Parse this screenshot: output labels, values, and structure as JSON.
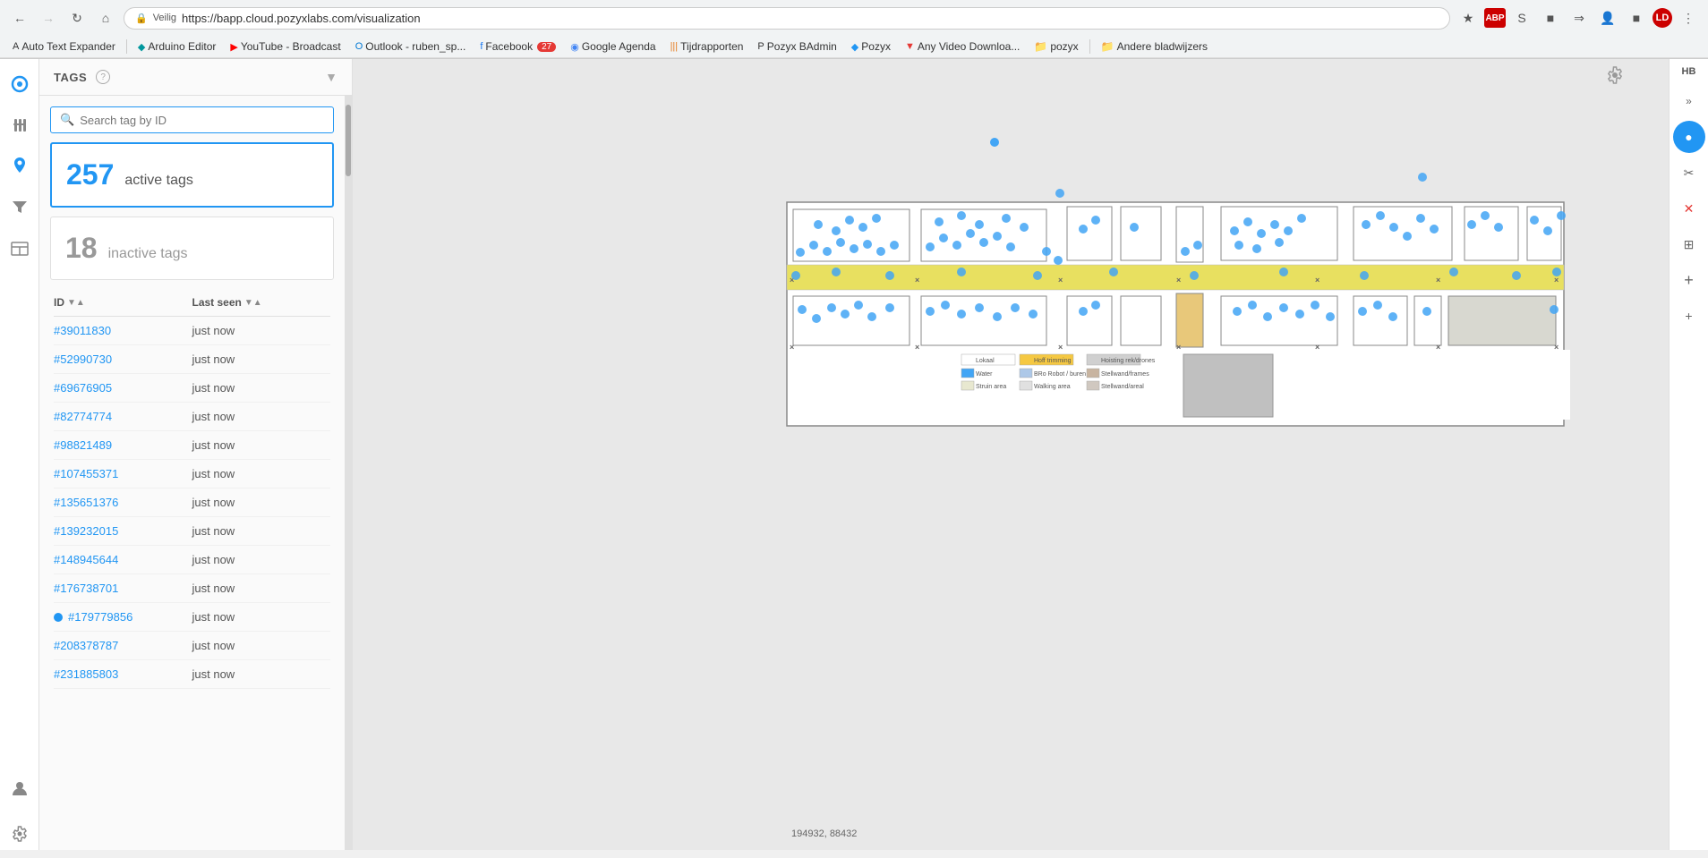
{
  "browser": {
    "url": "https://bapp.cloud.pozyxlabs.com/visualization",
    "security_label": "Veilig",
    "back_disabled": false,
    "forward_disabled": true,
    "bookmarks": [
      {
        "label": "Auto Text Expander",
        "icon": "A"
      },
      {
        "label": "Arduino Editor",
        "icon": "◆",
        "color": "#00979d"
      },
      {
        "label": "YouTube - Broadcast",
        "icon": "▶",
        "color": "#ff0000"
      },
      {
        "label": "Outlook - ruben_sp...",
        "icon": "O",
        "color": "#0078d4"
      },
      {
        "label": "Facebook",
        "icon": "f",
        "color": "#1877f2",
        "badge": "27"
      },
      {
        "label": "Google Agenda",
        "icon": "◉",
        "color": "#4285f4"
      },
      {
        "label": "Tijdrapporten",
        "icon": "|||",
        "color": "#e67e22"
      },
      {
        "label": "Pozyx BAdmin",
        "icon": "P",
        "color": "#333"
      },
      {
        "label": "Pozyx",
        "icon": "◆",
        "color": "#2196f3"
      },
      {
        "label": "Any Video Downloa...",
        "icon": "▼",
        "color": "#e53935"
      },
      {
        "label": "pozyx",
        "icon": "📁",
        "color": "#f9a825"
      },
      {
        "label": "Andere bladwijzers",
        "icon": "📁",
        "color": "#f9a825"
      }
    ]
  },
  "sidebar": {
    "items": [
      {
        "icon": "◆",
        "label": "pozyx-logo",
        "active": true
      },
      {
        "icon": "🔧",
        "label": "tools",
        "active": false
      },
      {
        "icon": "📍",
        "label": "location",
        "active": true
      },
      {
        "icon": "≡",
        "label": "settings",
        "active": false
      },
      {
        "icon": "🖼",
        "label": "floor",
        "active": false
      }
    ]
  },
  "tags_panel": {
    "title": "TAGS",
    "search_placeholder": "Search tag by ID",
    "active_count": "257",
    "active_label": "active tags",
    "inactive_count": "18",
    "inactive_label": "inactive tags",
    "table": {
      "col_id": "ID",
      "col_lastseen": "Last seen",
      "rows": [
        {
          "id": "#39011830",
          "lastseen": "just now",
          "dot": false
        },
        {
          "id": "#52990730",
          "lastseen": "just now",
          "dot": false
        },
        {
          "id": "#69676905",
          "lastseen": "just now",
          "dot": false
        },
        {
          "id": "#82774774",
          "lastseen": "just now",
          "dot": false
        },
        {
          "id": "#98821489",
          "lastseen": "just now",
          "dot": false
        },
        {
          "id": "#107455371",
          "lastseen": "just now",
          "dot": false
        },
        {
          "id": "#135651376",
          "lastseen": "just now",
          "dot": false
        },
        {
          "id": "#139232015",
          "lastseen": "just now",
          "dot": false
        },
        {
          "id": "#148945644",
          "lastseen": "just now",
          "dot": false
        },
        {
          "id": "#176738701",
          "lastseen": "just now",
          "dot": false
        },
        {
          "id": "#179779856",
          "lastseen": "just now",
          "dot": true
        },
        {
          "id": "#208378787",
          "lastseen": "just now",
          "dot": false
        },
        {
          "id": "#231885803",
          "lastseen": "just now",
          "dot": false
        }
      ]
    }
  },
  "legend": {
    "items": [
      {
        "color": "#ffffff",
        "label": "Lokaal"
      },
      {
        "color": "#f5c842",
        "label": "Hoff trimming"
      },
      {
        "color": "#d0d0d0",
        "label": "Hoisting rek/drones"
      },
      {
        "color": "#42a5f5",
        "label": "Water"
      },
      {
        "color": "#adc8e8",
        "label": "BRo Robot / buren"
      },
      {
        "color": "#c8b4a0",
        "label": "Stellwand/frames"
      },
      {
        "color": "#e8e8d0",
        "label": "Struin area"
      },
      {
        "color": "#e0e0e0",
        "label": "Walking area"
      },
      {
        "color": "#d0c8c0",
        "label": "Stellwand/areal"
      }
    ]
  },
  "coordinates": "194932, 88432",
  "right_toolbar": {
    "buttons": [
      {
        "label": "HB",
        "type": "text"
      },
      {
        "label": "»",
        "type": "icon"
      },
      {
        "label": "●",
        "type": "icon",
        "active": true
      },
      {
        "label": "✂",
        "type": "icon"
      },
      {
        "label": "✕",
        "type": "icon",
        "red": true
      },
      {
        "label": "⊞",
        "type": "icon"
      },
      {
        "label": "+",
        "type": "icon"
      },
      {
        "label": "+",
        "type": "icon",
        "small": true
      }
    ]
  },
  "colors": {
    "accent": "#2196f3",
    "active_tag": "#42a5f5",
    "inactive": "#999999",
    "border": "#e0e0e0"
  }
}
